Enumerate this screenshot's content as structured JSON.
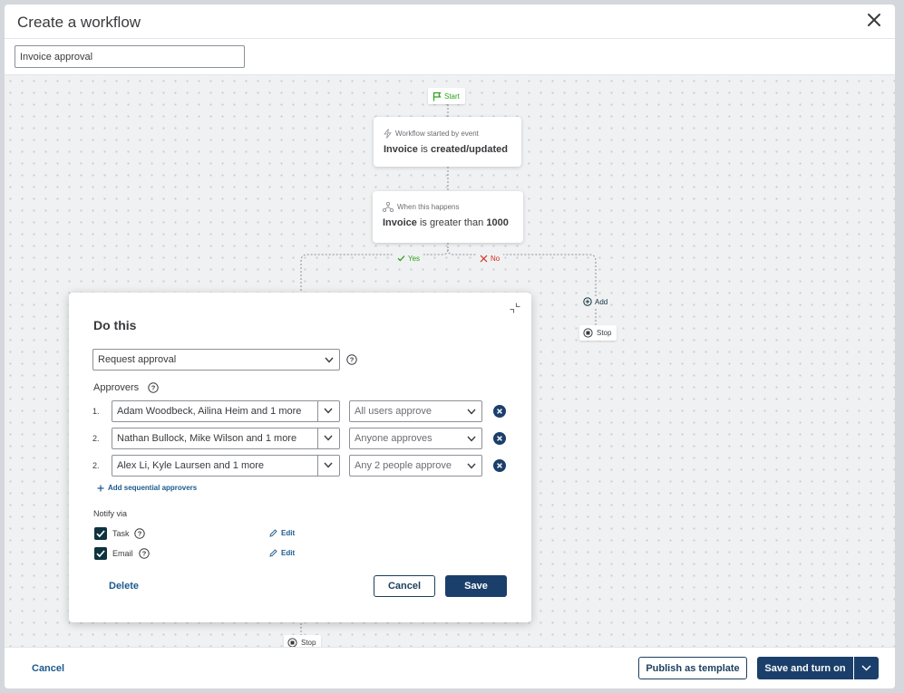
{
  "header": {
    "title": "Create a workflow"
  },
  "workflow_name": {
    "value": "Invoice approval"
  },
  "flow": {
    "start_label": "Start",
    "trigger": {
      "caption": "Workflow started by event",
      "subject": "Invoice",
      "verb": "is",
      "condition": "created/updated"
    },
    "condition": {
      "caption": "When this happens",
      "subject": "Invoice",
      "verb": "is greater than",
      "value": "1000"
    },
    "yes_label": "Yes",
    "no_label": "No",
    "add_label": "Add",
    "stop_label": "Stop"
  },
  "panel": {
    "title": "Do this",
    "action_select": "Request approval",
    "approvers_label": "Approvers",
    "approvers": [
      {
        "num": "1.",
        "names": "Adam Woodbeck, Ailina Heim and 1 more",
        "rule": "All users approve"
      },
      {
        "num": "2.",
        "names": "Nathan Bullock, Mike Wilson and 1 more",
        "rule": "Anyone approves"
      },
      {
        "num": "2.",
        "names": "Alex Li, Kyle Laursen and 1 more",
        "rule": "Any 2 people approve"
      }
    ],
    "add_sequential": "Add sequential approvers",
    "notify_label": "Notify via",
    "notify": [
      {
        "label": "Task",
        "edit": "Edit"
      },
      {
        "label": "Email",
        "edit": "Edit"
      }
    ],
    "delete_label": "Delete",
    "cancel_label": "Cancel",
    "save_label": "Save"
  },
  "footer": {
    "cancel_label": "Cancel",
    "publish_label": "Publish as template",
    "save_on_label": "Save and turn on"
  },
  "colors": {
    "accent": "#1b3f6b",
    "yes": "#2ca01c",
    "no": "#d52b1e",
    "checkbox": "#0d333f"
  }
}
